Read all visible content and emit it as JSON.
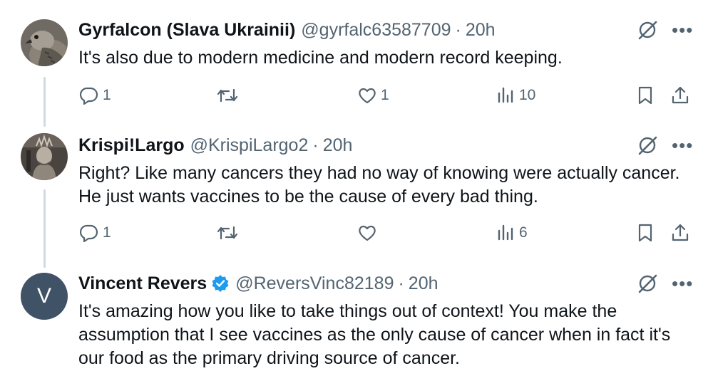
{
  "tweets": [
    {
      "display_name": "Gyrfalcon (Slava Ukrainii)",
      "handle": "@gyrfalc63587709",
      "separator": "·",
      "time": "20h",
      "text": "It's also due to modern medicine and modern record keeping.",
      "verified": false,
      "avatar": "falcon-photo",
      "replies": "1",
      "retweets": "",
      "likes": "1",
      "views": "10"
    },
    {
      "display_name": "Krispi!Largo",
      "handle": "@KrispiLargo2",
      "separator": "·",
      "time": "20h",
      "text": "Right? Like many cancers they had no way of knowing were actually cancer. He just wants vaccines to be the cause of every bad thing.",
      "verified": false,
      "avatar": "statue-of-liberty-photo",
      "replies": "1",
      "retweets": "",
      "likes": "",
      "views": "6"
    },
    {
      "display_name": "Vincent Revers",
      "handle": "@ReversVinc82189",
      "separator": "·",
      "time": "20h",
      "text": "It's amazing how you like to take things out of context! You make the assumption that I see vaccines as the only cause of cancer when in fact it's our food as the primary driving source of cancer.",
      "verified": true,
      "avatar_letter": "V",
      "avatar": "letter-avatar"
    }
  ],
  "more_glyph": "•••",
  "colors": {
    "text": "#0f1419",
    "secondary": "#536471",
    "thread_line": "#cfd9de",
    "verified_blue": "#1d9bf0",
    "letter_avatar": "#3f5266"
  },
  "icons": [
    "reply-icon",
    "retweet-icon",
    "like-icon",
    "views-icon",
    "bookmark-icon",
    "share-icon",
    "grok-icon",
    "more-icon",
    "verified-badge-icon"
  ]
}
